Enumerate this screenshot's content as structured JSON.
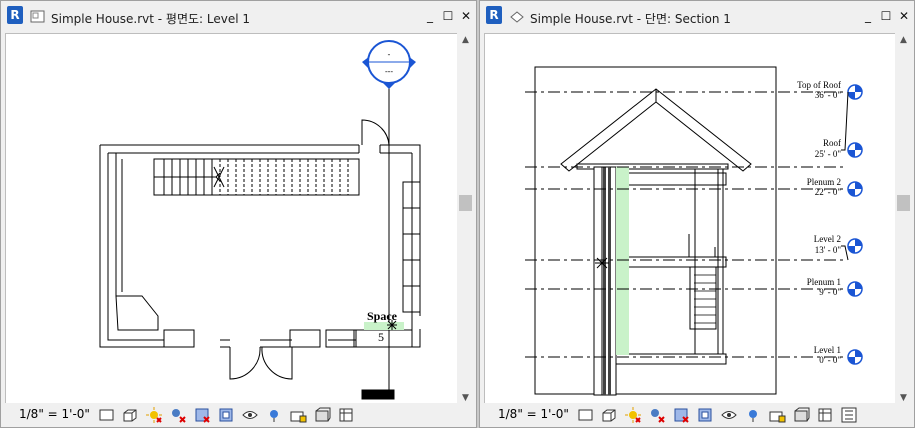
{
  "app": {
    "badge": "R"
  },
  "left_view": {
    "title": "Simple House.rvt - 평면도: Level 1",
    "scale": "1/8\" = 1'-0\"",
    "room_tag_name": "Space",
    "room_tag_number": "5",
    "section_head_top": "-",
    "section_head_bottom": "---"
  },
  "right_view": {
    "title": "Simple House.rvt - 단면: Section 1",
    "scale": "1/8\" = 1'-0\"",
    "levels": [
      {
        "name": "Top of Roof",
        "elevation": "36' - 0\""
      },
      {
        "name": "Roof",
        "elevation": "25' - 0\""
      },
      {
        "name": "Plenum 2",
        "elevation": "22' - 0\""
      },
      {
        "name": "Level 2",
        "elevation": "13' - 0\""
      },
      {
        "name": "Plenum 1",
        "elevation": "9' - 0\""
      },
      {
        "name": "Level 1",
        "elevation": "0' - 0\""
      }
    ]
  },
  "window_controls": {
    "minimize": "_",
    "maximize": "☐",
    "close": "✕"
  },
  "toolbar_icons": [
    "detail-level-icon",
    "visual-style-icon",
    "sun-path-icon",
    "shadows-icon",
    "crop-view-icon",
    "show-crop-region-icon",
    "temporary-hide-icon",
    "reveal-hidden-icon",
    "lock-3d-view-icon",
    "analytical-model-icon",
    "highlight-displacement-icon",
    "reveal-constraints-icon"
  ]
}
